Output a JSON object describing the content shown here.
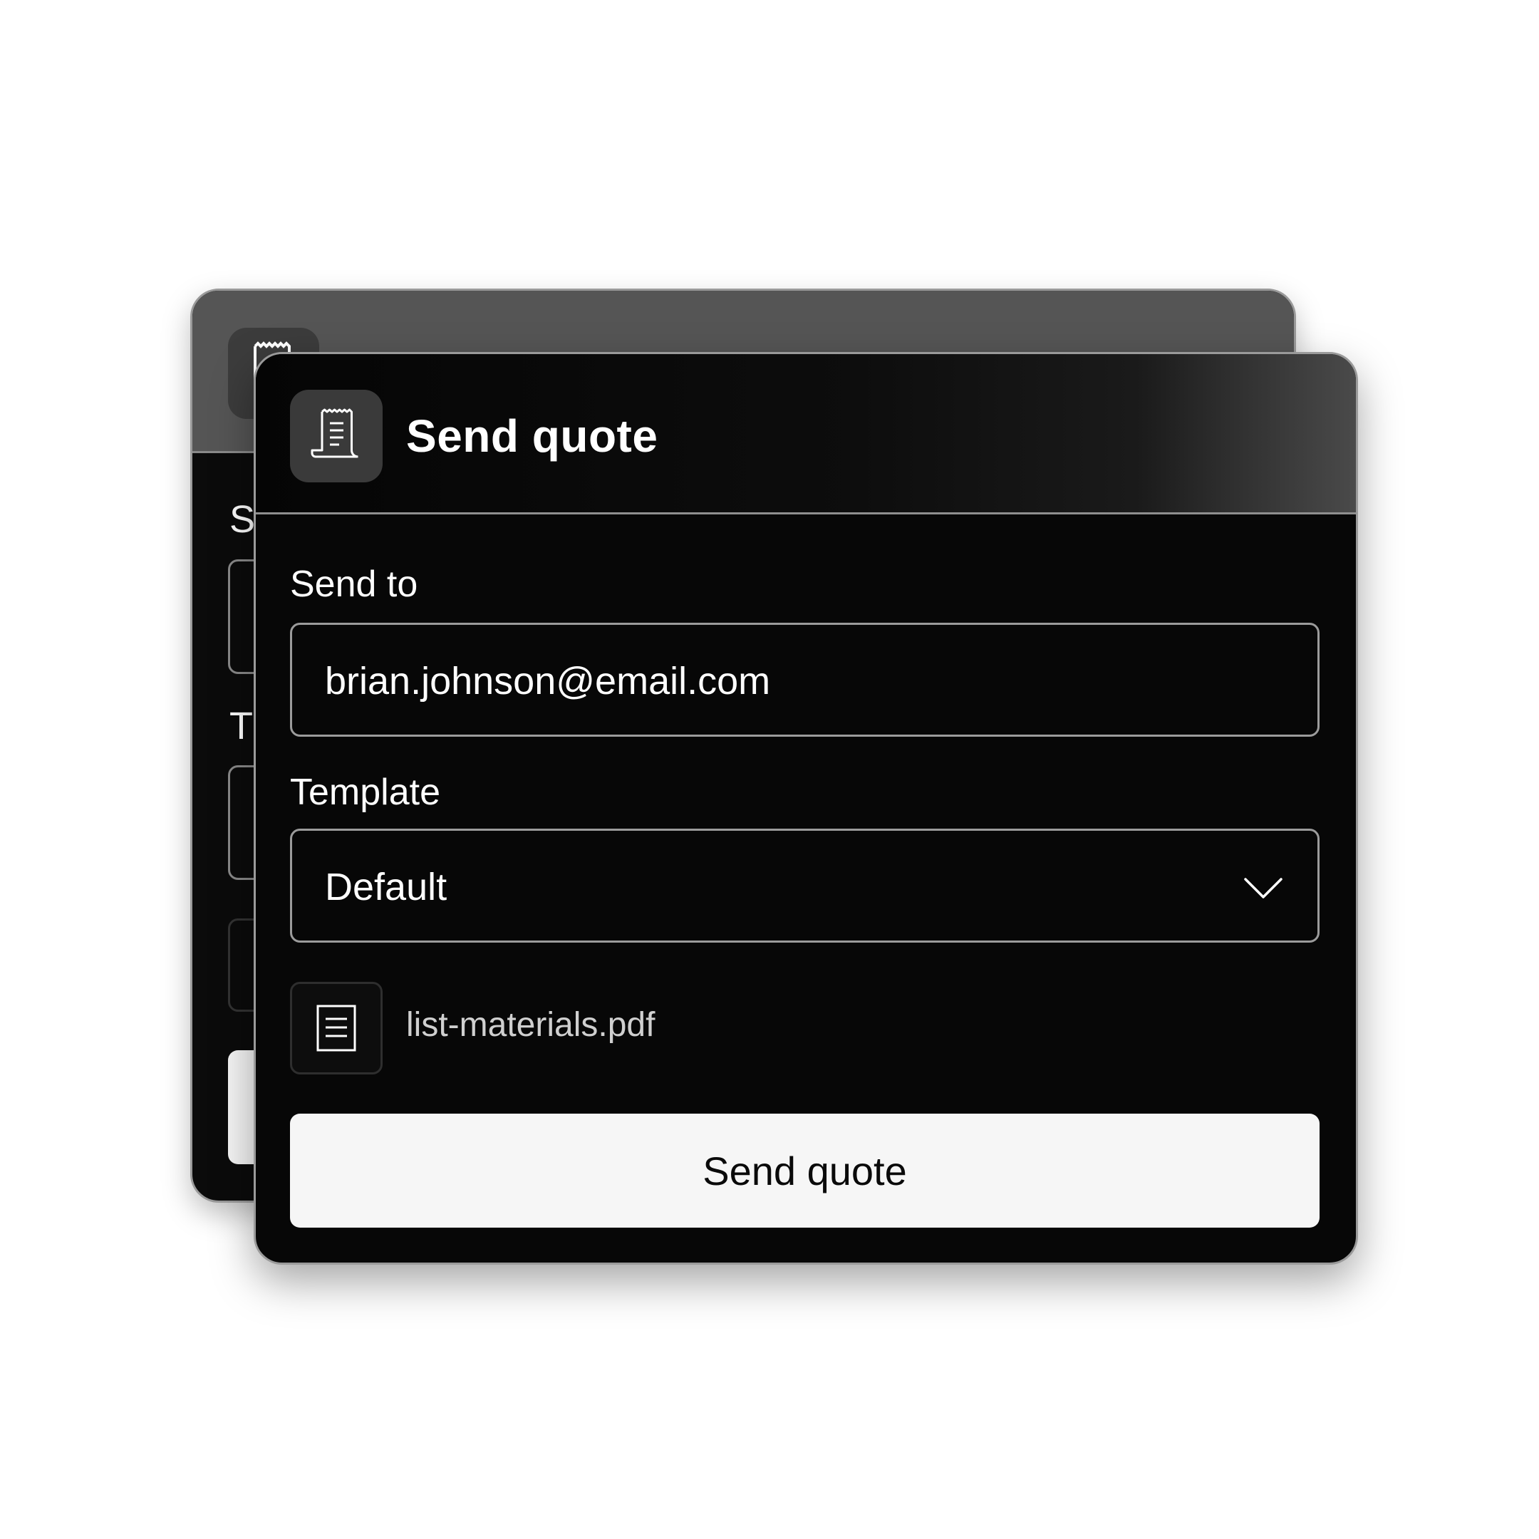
{
  "background_card": {
    "partial_label_1": "S",
    "partial_label_2": "T"
  },
  "dialog": {
    "title": "Send quote",
    "header_icon": "receipt-icon",
    "send_to": {
      "label": "Send to",
      "value": "brian.johnson@email.com"
    },
    "template": {
      "label": "Template",
      "selected": "Default",
      "dropdown_icon": "chevron-down-icon"
    },
    "attachment": {
      "icon": "document-icon",
      "filename": "list-materials.pdf"
    },
    "submit_label": "Send quote"
  },
  "colors": {
    "card_background": "#070707",
    "header_tile": "#3a3a3a",
    "button_background": "#f6f6f6",
    "border": "#9b9b9b",
    "page_background": "#ffffff"
  }
}
